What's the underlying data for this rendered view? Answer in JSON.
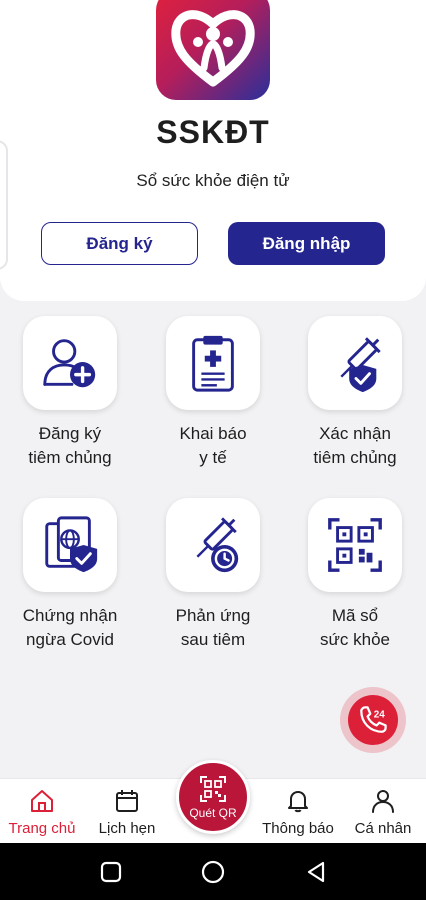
{
  "header": {
    "app_title": "SSKĐT",
    "app_subtitle": "Sổ sức khỏe điện tử",
    "register_label": "Đăng ký",
    "login_label": "Đăng nhập"
  },
  "grid": [
    {
      "line1": "Đăng ký",
      "line2": "tiêm chủng",
      "icon": "add-user-icon"
    },
    {
      "line1": "Khai báo",
      "line2": "y tế",
      "icon": "medical-clipboard-icon"
    },
    {
      "line1": "Xác nhận",
      "line2": "tiêm chủng",
      "icon": "syringe-shield-icon"
    },
    {
      "line1": "Chứng nhận",
      "line2": "ngừa Covid",
      "icon": "passport-shield-icon"
    },
    {
      "line1": "Phản ứng",
      "line2": "sau tiêm",
      "icon": "syringe-clock-icon"
    },
    {
      "line1": "Mã sổ",
      "line2": "sức khỏe",
      "icon": "qr-code-icon"
    }
  ],
  "hotline": {
    "label": "24",
    "icon": "phone-24-icon"
  },
  "bottom_nav": {
    "home": "Trang chủ",
    "calendar": "Lịch hẹn",
    "scan_qr": "Quét QR",
    "notifications": "Thông báo",
    "profile": "Cá nhân"
  },
  "colors": {
    "primary": "#25258f",
    "accent": "#dc2038",
    "background": "#f2f2f4"
  }
}
